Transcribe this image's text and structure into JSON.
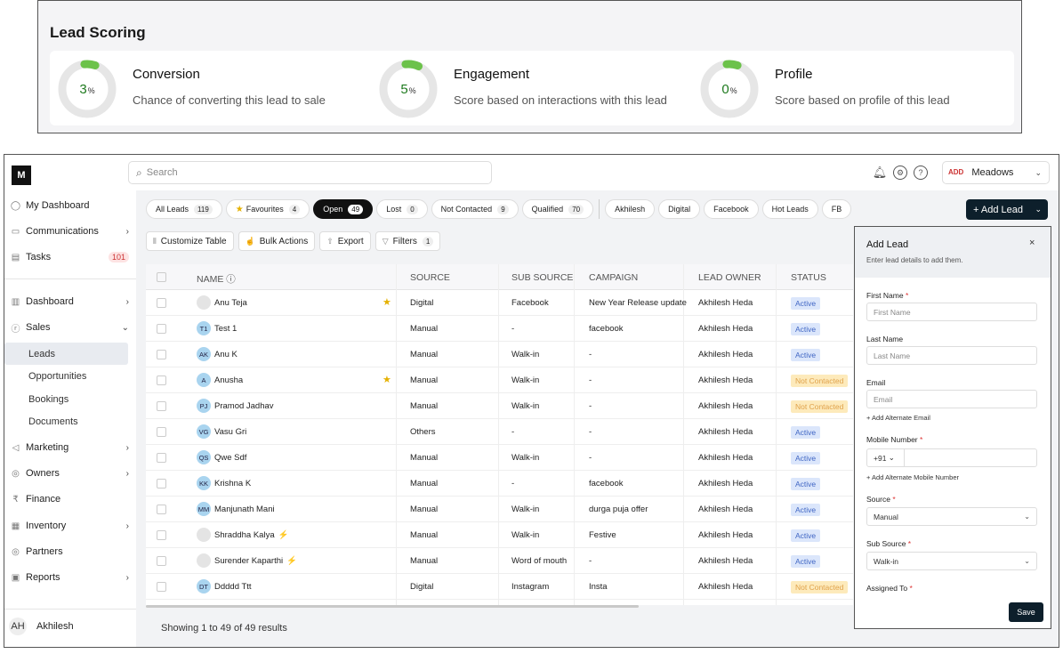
{
  "lead_scoring": {
    "title": "Lead Scoring",
    "scores": [
      {
        "value": "3",
        "unit": "%",
        "pct": 3,
        "name": "Conversion",
        "desc": "Chance of converting this lead to sale"
      },
      {
        "value": "5",
        "unit": "%",
        "pct": 5,
        "name": "Engagement",
        "desc": "Score based on interactions with this lead"
      },
      {
        "value": "0",
        "unit": "%",
        "pct": 0,
        "name": "Profile",
        "desc": "Score based on profile of this lead"
      }
    ]
  },
  "colors": {
    "accent": "#0d1f2b",
    "score_green": "#6cc24a",
    "ring_gray": "#e6e6e6",
    "active_badge": "#dbe6fb",
    "not_contacted_badge": "#fdeabb"
  },
  "search": {
    "placeholder": "Search"
  },
  "org": {
    "mark": "ADD",
    "name": "Meadows"
  },
  "sidebar": {
    "items": [
      {
        "label": "My Dashboard",
        "icon": "user-icon"
      },
      {
        "label": "Communications",
        "icon": "chat-icon"
      },
      {
        "label": "Tasks",
        "icon": "calendar-icon",
        "count": "101"
      },
      {
        "label": "Dashboard",
        "icon": "chart-icon"
      },
      {
        "label": "Sales",
        "icon": "currency-icon"
      }
    ],
    "sales_sub": [
      "Leads",
      "Opportunities",
      "Bookings",
      "Documents"
    ],
    "items2": [
      {
        "label": "Marketing",
        "icon": "megaphone-icon"
      },
      {
        "label": "Owners",
        "icon": "people-icon"
      },
      {
        "label": "Finance",
        "icon": "rupee-icon"
      },
      {
        "label": "Inventory",
        "icon": "building-icon"
      },
      {
        "label": "Partners",
        "icon": "people-icon"
      },
      {
        "label": "Reports",
        "icon": "report-icon"
      }
    ],
    "user": {
      "initials": "AH",
      "name": "Akhilesh"
    }
  },
  "chips": [
    {
      "label": "All Leads",
      "count": "119"
    },
    {
      "label": "Favourites",
      "count": "4"
    },
    {
      "label": "Open",
      "count": "49"
    },
    {
      "label": "Lost",
      "count": "0"
    },
    {
      "label": "Not Contacted",
      "count": "9"
    },
    {
      "label": "Qualified",
      "count": "70"
    }
  ],
  "saved_filters": [
    "Akhilesh",
    "Digital",
    "Facebook",
    "Hot Leads",
    "FB"
  ],
  "add_lead_label": "+ Add Lead",
  "tools": {
    "customize": "Customize Table",
    "bulk": "Bulk Actions",
    "export": "Export",
    "filters": "Filters",
    "filters_count": "1"
  },
  "table": {
    "headers": [
      "NAME",
      "SOURCE",
      "SUB SOURCE",
      "CAMPAIGN",
      "LEAD OWNER",
      "STATUS"
    ],
    "rows": [
      {
        "initials": "",
        "name": "Anu Teja",
        "fav": "★",
        "source": "Digital",
        "sub": "Facebook",
        "campaign": "New Year Release update",
        "owner": "Akhilesh Heda",
        "status": "Active"
      },
      {
        "initials": "T1",
        "name": "Test 1",
        "fav": "",
        "source": "Manual",
        "sub": "-",
        "campaign": "facebook",
        "owner": "Akhilesh Heda",
        "status": "Active"
      },
      {
        "initials": "AK",
        "name": "Anu K",
        "fav": "",
        "source": "Manual",
        "sub": "Walk-in",
        "campaign": "-",
        "owner": "Akhilesh Heda",
        "status": "Active"
      },
      {
        "initials": "A",
        "name": "Anusha",
        "fav": "★",
        "source": "Manual",
        "sub": "Walk-in",
        "campaign": "-",
        "owner": "Akhilesh Heda",
        "status": "Not Contacted"
      },
      {
        "initials": "PJ",
        "name": "Pramod Jadhav",
        "fav": "",
        "source": "Manual",
        "sub": "Walk-in",
        "campaign": "-",
        "owner": "Akhilesh Heda",
        "status": "Not Contacted"
      },
      {
        "initials": "VG",
        "name": "Vasu Gri",
        "fav": "",
        "source": "Others",
        "sub": "-",
        "campaign": "-",
        "owner": "Akhilesh Heda",
        "status": "Active"
      },
      {
        "initials": "QS",
        "name": "Qwe Sdf",
        "fav": "",
        "source": "Manual",
        "sub": "Walk-in",
        "campaign": "-",
        "owner": "Akhilesh Heda",
        "status": "Active"
      },
      {
        "initials": "KK",
        "name": "Krishna K",
        "fav": "",
        "source": "Manual",
        "sub": "-",
        "campaign": "facebook",
        "owner": "Akhilesh Heda",
        "status": "Active"
      },
      {
        "initials": "MM",
        "name": "Manjunath Mani",
        "fav": "",
        "source": "Manual",
        "sub": "Walk-in",
        "campaign": "durga puja offer",
        "owner": "Akhilesh Heda",
        "status": "Active"
      },
      {
        "initials": "",
        "name": "Shraddha Kalya",
        "fav": "",
        "bolt": "⚡",
        "source": "Manual",
        "sub": "Walk-in",
        "campaign": "Festive",
        "owner": "Akhilesh Heda",
        "status": "Active"
      },
      {
        "initials": "",
        "name": "Surender Kaparthi",
        "fav": "",
        "bolt": "⚡",
        "source": "Manual",
        "sub": "Word of mouth",
        "campaign": "-",
        "owner": "Akhilesh Heda",
        "status": "Active"
      },
      {
        "initials": "DT",
        "name": "Ddddd Ttt",
        "fav": "",
        "source": "Digital",
        "sub": "Instagram",
        "campaign": "Insta",
        "owner": "Akhilesh Heda",
        "status": "Not Contacted"
      }
    ]
  },
  "footer": {
    "text": "Showing 1 to 49 of 49 results"
  },
  "drawer": {
    "title": "Add Lead",
    "subtitle": "Enter lead details to add them.",
    "first_name": {
      "label": "First Name",
      "placeholder": "First Name"
    },
    "last_name": {
      "label": "Last Name",
      "placeholder": "Last Name"
    },
    "email": {
      "label": "Email",
      "placeholder": "Email",
      "link": "+ Add Alternate Email"
    },
    "mobile": {
      "label": "Mobile Number",
      "code": "+91",
      "link": "+ Add Alternate Mobile Number"
    },
    "source": {
      "label": "Source",
      "value": "Manual"
    },
    "sub_source": {
      "label": "Sub Source",
      "value": "Walk-in"
    },
    "assigned": {
      "label": "Assigned To"
    },
    "save_label": "Save"
  }
}
